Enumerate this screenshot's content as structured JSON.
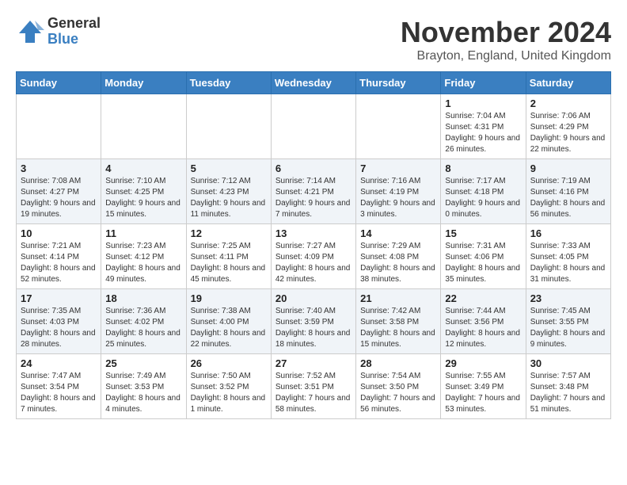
{
  "logo": {
    "general": "General",
    "blue": "Blue"
  },
  "title": "November 2024",
  "location": "Brayton, England, United Kingdom",
  "days_of_week": [
    "Sunday",
    "Monday",
    "Tuesday",
    "Wednesday",
    "Thursday",
    "Friday",
    "Saturday"
  ],
  "weeks": [
    [
      {
        "day": "",
        "info": ""
      },
      {
        "day": "",
        "info": ""
      },
      {
        "day": "",
        "info": ""
      },
      {
        "day": "",
        "info": ""
      },
      {
        "day": "",
        "info": ""
      },
      {
        "day": "1",
        "info": "Sunrise: 7:04 AM\nSunset: 4:31 PM\nDaylight: 9 hours and 26 minutes."
      },
      {
        "day": "2",
        "info": "Sunrise: 7:06 AM\nSunset: 4:29 PM\nDaylight: 9 hours and 22 minutes."
      }
    ],
    [
      {
        "day": "3",
        "info": "Sunrise: 7:08 AM\nSunset: 4:27 PM\nDaylight: 9 hours and 19 minutes."
      },
      {
        "day": "4",
        "info": "Sunrise: 7:10 AM\nSunset: 4:25 PM\nDaylight: 9 hours and 15 minutes."
      },
      {
        "day": "5",
        "info": "Sunrise: 7:12 AM\nSunset: 4:23 PM\nDaylight: 9 hours and 11 minutes."
      },
      {
        "day": "6",
        "info": "Sunrise: 7:14 AM\nSunset: 4:21 PM\nDaylight: 9 hours and 7 minutes."
      },
      {
        "day": "7",
        "info": "Sunrise: 7:16 AM\nSunset: 4:19 PM\nDaylight: 9 hours and 3 minutes."
      },
      {
        "day": "8",
        "info": "Sunrise: 7:17 AM\nSunset: 4:18 PM\nDaylight: 9 hours and 0 minutes."
      },
      {
        "day": "9",
        "info": "Sunrise: 7:19 AM\nSunset: 4:16 PM\nDaylight: 8 hours and 56 minutes."
      }
    ],
    [
      {
        "day": "10",
        "info": "Sunrise: 7:21 AM\nSunset: 4:14 PM\nDaylight: 8 hours and 52 minutes."
      },
      {
        "day": "11",
        "info": "Sunrise: 7:23 AM\nSunset: 4:12 PM\nDaylight: 8 hours and 49 minutes."
      },
      {
        "day": "12",
        "info": "Sunrise: 7:25 AM\nSunset: 4:11 PM\nDaylight: 8 hours and 45 minutes."
      },
      {
        "day": "13",
        "info": "Sunrise: 7:27 AM\nSunset: 4:09 PM\nDaylight: 8 hours and 42 minutes."
      },
      {
        "day": "14",
        "info": "Sunrise: 7:29 AM\nSunset: 4:08 PM\nDaylight: 8 hours and 38 minutes."
      },
      {
        "day": "15",
        "info": "Sunrise: 7:31 AM\nSunset: 4:06 PM\nDaylight: 8 hours and 35 minutes."
      },
      {
        "day": "16",
        "info": "Sunrise: 7:33 AM\nSunset: 4:05 PM\nDaylight: 8 hours and 31 minutes."
      }
    ],
    [
      {
        "day": "17",
        "info": "Sunrise: 7:35 AM\nSunset: 4:03 PM\nDaylight: 8 hours and 28 minutes."
      },
      {
        "day": "18",
        "info": "Sunrise: 7:36 AM\nSunset: 4:02 PM\nDaylight: 8 hours and 25 minutes."
      },
      {
        "day": "19",
        "info": "Sunrise: 7:38 AM\nSunset: 4:00 PM\nDaylight: 8 hours and 22 minutes."
      },
      {
        "day": "20",
        "info": "Sunrise: 7:40 AM\nSunset: 3:59 PM\nDaylight: 8 hours and 18 minutes."
      },
      {
        "day": "21",
        "info": "Sunrise: 7:42 AM\nSunset: 3:58 PM\nDaylight: 8 hours and 15 minutes."
      },
      {
        "day": "22",
        "info": "Sunrise: 7:44 AM\nSunset: 3:56 PM\nDaylight: 8 hours and 12 minutes."
      },
      {
        "day": "23",
        "info": "Sunrise: 7:45 AM\nSunset: 3:55 PM\nDaylight: 8 hours and 9 minutes."
      }
    ],
    [
      {
        "day": "24",
        "info": "Sunrise: 7:47 AM\nSunset: 3:54 PM\nDaylight: 8 hours and 7 minutes."
      },
      {
        "day": "25",
        "info": "Sunrise: 7:49 AM\nSunset: 3:53 PM\nDaylight: 8 hours and 4 minutes."
      },
      {
        "day": "26",
        "info": "Sunrise: 7:50 AM\nSunset: 3:52 PM\nDaylight: 8 hours and 1 minute."
      },
      {
        "day": "27",
        "info": "Sunrise: 7:52 AM\nSunset: 3:51 PM\nDaylight: 7 hours and 58 minutes."
      },
      {
        "day": "28",
        "info": "Sunrise: 7:54 AM\nSunset: 3:50 PM\nDaylight: 7 hours and 56 minutes."
      },
      {
        "day": "29",
        "info": "Sunrise: 7:55 AM\nSunset: 3:49 PM\nDaylight: 7 hours and 53 minutes."
      },
      {
        "day": "30",
        "info": "Sunrise: 7:57 AM\nSunset: 3:48 PM\nDaylight: 7 hours and 51 minutes."
      }
    ]
  ]
}
